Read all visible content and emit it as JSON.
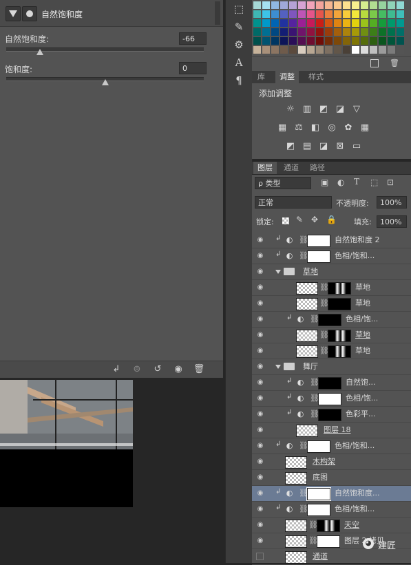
{
  "properties": {
    "header_title": "自然饱和度",
    "vibrance_label": "自然饱和度:",
    "vibrance_value": "-66",
    "vibrance_level": 0.17,
    "saturation_label": "饱和度:",
    "saturation_value": "0",
    "saturation_level": 0.5
  },
  "tools": [
    "3d-icon",
    "brush-icon",
    "adjust-icon",
    "text-icon",
    "paragraph-icon"
  ],
  "swatches": {
    "rows": [
      [
        "#a6d8d6",
        "#a6e0f0",
        "#8fb7e3",
        "#9fa8d8",
        "#b6a3d6",
        "#d6a3d3",
        "#f0a3b9",
        "#f2a39b",
        "#f5b690",
        "#fac98e",
        "#fce08e",
        "#f7f08e",
        "#d6ec8f",
        "#b2dd92",
        "#96d39e",
        "#8fd3b8",
        "#8fd8d3"
      ],
      [
        "#3fb7b3",
        "#3ec4e6",
        "#3d8ed2",
        "#5461c0",
        "#7f56bf",
        "#bd55b6",
        "#e4558a",
        "#e5554c",
        "#ea7f3d",
        "#f3a43b",
        "#f8cc3b",
        "#f1e73b",
        "#b8db3f",
        "#7bc94a",
        "#46bb62",
        "#3fbb91",
        "#3fbfba"
      ],
      [
        "#00928d",
        "#0099c9",
        "#0064b3",
        "#2132a0",
        "#55239f",
        "#9c1f96",
        "#c81a5a",
        "#cb1d16",
        "#d45511",
        "#e08312",
        "#eab314",
        "#e2d20e",
        "#9bc31b",
        "#54ad23",
        "#169c3b",
        "#00996b",
        "#009a91"
      ],
      [
        "#006a67",
        "#006f93",
        "#004882",
        "#131e74",
        "#3a1472",
        "#70146b",
        "#911240",
        "#93130e",
        "#9a3c0b",
        "#a45f0c",
        "#ac830c",
        "#a69a08",
        "#708f12",
        "#3c7e18",
        "#0d7128",
        "#00704d",
        "#006f69"
      ],
      [
        "#00504c",
        "#005370",
        "#003662",
        "#0d1558",
        "#2b0e57",
        "#540e51",
        "#6e0c30",
        "#700c08",
        "#752d07",
        "#7d4808",
        "#836408",
        "#7f7505",
        "#556c0c",
        "#2d5f11",
        "#09551e",
        "#00553a",
        "#00534f"
      ],
      [
        "#c6b29a",
        "#a8907a",
        "#8c7562",
        "#6f5b4b",
        "#5b4a3d",
        "#d9cdbf",
        "#b8a793",
        "#9b8b79",
        "#7d6f61",
        "#625649",
        "#4a4037",
        "#ffffff",
        "#dcdcdc",
        "#bfbfbf",
        "#9b9b9b",
        "#7b7b7b",
        "#545454"
      ]
    ]
  },
  "adjustments": {
    "tabs": [
      "库",
      "调整",
      "样式"
    ],
    "active_tab": "调整",
    "title": "添加调整",
    "icon_rows": [
      [
        "brightness-icon",
        "levels-icon",
        "curves-icon",
        "exposure-icon",
        "triangle-icon"
      ],
      [
        "vibrance-icon",
        "balance-icon",
        "bw-icon",
        "camera-icon",
        "mixer-icon",
        "grid-icon"
      ],
      [
        "invert-icon",
        "posterize-icon",
        "threshold-icon",
        "selective-icon",
        "gradient-icon"
      ]
    ]
  },
  "layers_panel": {
    "tabs": [
      "图层",
      "通道",
      "路径"
    ],
    "active_tab": "图层",
    "filter_kind": "ρ 类型",
    "blend_mode": "正常",
    "opacity_label": "不透明度:",
    "opacity_value": "100%",
    "lock_label": "锁定:",
    "fill_label": "填充:",
    "fill_value": "100%",
    "layers": [
      {
        "name": "自然饱和度 2",
        "indent": 0,
        "kind": "adjust",
        "clip": true,
        "mask": "white"
      },
      {
        "name": "色相/饱和...",
        "indent": 0,
        "kind": "adjust",
        "clip": true,
        "mask": "white"
      },
      {
        "name": "草地",
        "indent": 0,
        "kind": "group",
        "underline": true
      },
      {
        "name": "草地",
        "indent": 1,
        "kind": "pixel",
        "mask": "black-white"
      },
      {
        "name": "草地",
        "indent": 1,
        "kind": "pixel",
        "mask": "black"
      },
      {
        "name": "色相/饱...",
        "indent": 1,
        "kind": "adjust",
        "clip": true,
        "mask": "black"
      },
      {
        "name": "草地",
        "indent": 1,
        "kind": "pixel",
        "mask": "black-white",
        "underline": true
      },
      {
        "name": "草地",
        "indent": 1,
        "kind": "pixel",
        "mask": "black-white"
      },
      {
        "name": "舞厅",
        "indent": 0,
        "kind": "group"
      },
      {
        "name": "自然饱...",
        "indent": 1,
        "kind": "adjust",
        "clip": true,
        "mask": "black"
      },
      {
        "name": "色相/饱...",
        "indent": 1,
        "kind": "adjust",
        "clip": true,
        "mask": "white"
      },
      {
        "name": "色彩平...",
        "indent": 1,
        "kind": "adjust",
        "clip": true,
        "mask": "black"
      },
      {
        "name": "图层 18",
        "indent": 1,
        "kind": "pixel",
        "underline": true
      },
      {
        "name": "色相/饱和...",
        "indent": 0,
        "kind": "adjust",
        "clip": true,
        "mask": "white"
      },
      {
        "name": "木构架",
        "indent": 0,
        "kind": "pixel",
        "underline": true
      },
      {
        "name": "底图",
        "indent": 0,
        "kind": "pixel"
      },
      {
        "name": "自然饱和度...",
        "indent": 0,
        "kind": "adjust",
        "clip": true,
        "mask": "white",
        "selected": true
      },
      {
        "name": "色相/饱和...",
        "indent": 0,
        "kind": "adjust",
        "clip": true,
        "mask": "white"
      },
      {
        "name": "天空",
        "indent": 0,
        "kind": "pixel",
        "mask": "black-white",
        "underline": true
      },
      {
        "name": "图层 2 拷贝",
        "indent": 0,
        "kind": "pixel",
        "mask": "white"
      },
      {
        "name": "通道",
        "indent": 0,
        "kind": "pixel",
        "underline": true,
        "hidden": true
      }
    ]
  },
  "watermark": "建匠"
}
